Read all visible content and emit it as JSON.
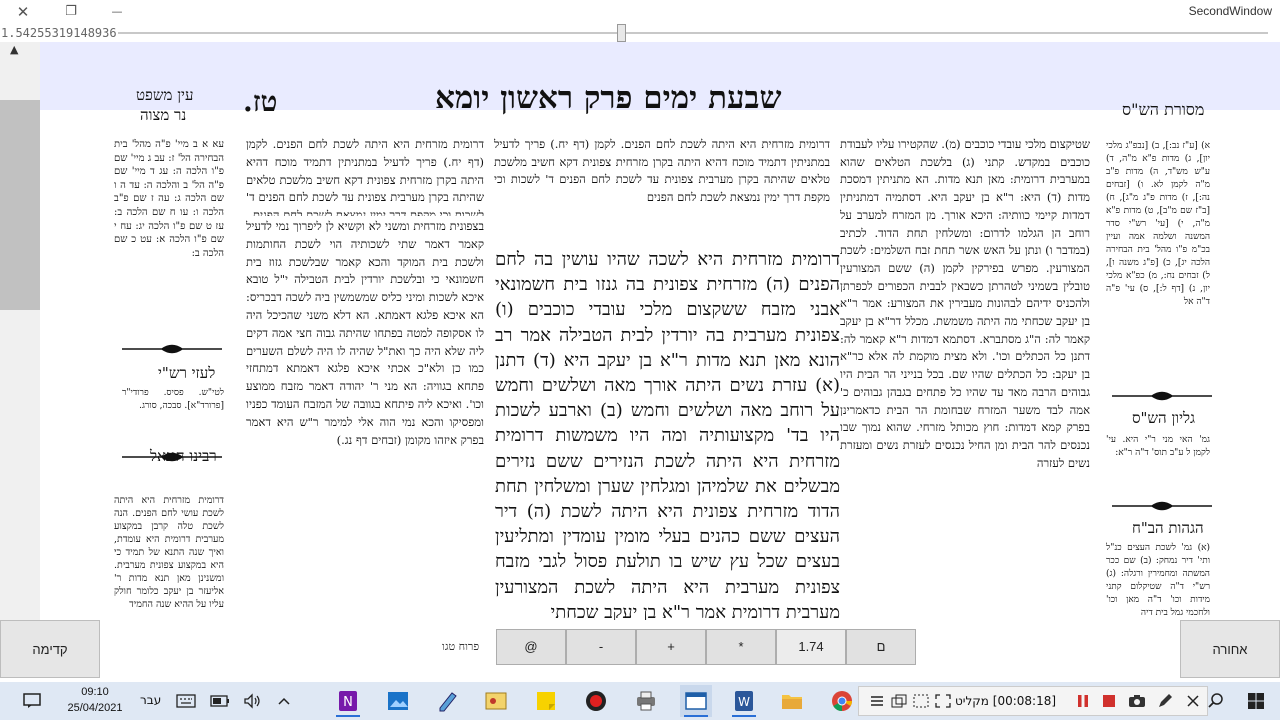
{
  "window": {
    "title": "SecondWindow",
    "close_glyph": "✕",
    "restore_glyph": "❐",
    "minimize_glyph": "—"
  },
  "coord_readout": "1.54255319148936",
  "scroll_up_glyph": "▲",
  "page": {
    "header_main": "שבעת ימים   פרק ראשון   יומא",
    "page_number": "טז.",
    "masoret_title": "מסורת הש\"ס",
    "ein_title": "עין משפט",
    "ner_title": "נר מצוה",
    "masoret_text": "א) [ע\"ז נב:], ב) [נבפ\"ג מלכי יון], ג) מדות פ\"א מ\"ה, ד) ע\"ש מש\"ד, ה) מדות פ\"ב מ\"ה לקמן לא. ו) [זבחים נה:], ז) מדות פ\"ג מ\"ג], ח) [ב\"ז שם מ\"ב], ט) מדות פ\"א מ\"ה, י) [עי' רש\"י סדר המשנה ושלמה אמה ועיין בכ\"מ פ\"ו מהל' בית הבחירה הלכה יג], כ) [פ\"ג משנה ו], ל) זבחים נח:, מ) כפ\"א מלכי יון, נ) [דף ל:], ס) עי' פ\"ה ד\"ה אל",
    "ein_text": "עא א ב מיי' פ\"ה מהל' בית הבחירה הל' ז: עב ג מיי' שם פ\"ו הלכה ה: עג ד מיי' שם פ\"ה הל' ב והלכה ה: עד ה ו שם הלכה ג: עה ז שם פ\"ב הלכה ו: עו ח שם הלכה ב: עז ט שם פ\"ו הלכה יג: עח י שם פ\"ו הלכה א: עט כ שם הלכה ב:",
    "laaz_title": "לעזי רש\"י",
    "laaz_text": "לטי\"ש. פסיס. פרודי\"ר [פרורד\"א]. סבכה, סורג.",
    "chananel_title": "רבינו חננאל",
    "chananel_text": "דרומית מזרחית היא היתה לשכת עושי לחם הפנים. הנה לשכת טלה קרבן במקצוע מערבית דרומית היא עומדת, ואיך שנה התנא של תמיד כי היא במקצוע צפונית מערבית. ומשנינן מאן תנא מדות ר' אליעזר בן יעקב כלומר חולק עליו על ההיא שנה החמיד",
    "gilyon_title": "גליון הש\"ס",
    "gilyon_text": "גמ' האי מני ר\"י היא. עי' לקמן ל ע\"ב תוס' ד\"ה ר\"א:",
    "hagahot_title": "הגהות הב\"ח",
    "hagahot_text": "(א) גמ' לשכת העצים כנ\"ל ותי' דיר נמחק: (ב) שם ככר המשתה ומחמירין ורגלה: (ג) רש\"י ד\"ה שטיקלום קתני מידות וכו' ד\"ה מאן וכו' ולחכמי גמל בית דיה",
    "rashi_right": "שטיקצום מלכי עובדי כוכבים (מ). שהקטירו עליו לעבודת כוכבים במקדש. קתני (ג) בלשכת הטלאים שהוא במערבית דרומית: מאן תנא מדות. הא מתניתין דמסכת מדות (ד) היא: ר\"א בן יעקב היא. דסתמיה דמתניתין דמדות קיימי כוותיה: היכא אורך. מן המזרח למערב על רוחב הן הגלמו לדרום: ומשלחין תחת הדוד. לכתיב (במדבר ו) ונתן על האש אשר תחת זבח השלמים: לשכת המצורעין. מפרש בפירקין לקמן (ה) ששם המצורעין טובלין בשמיני לטהרתן כשבאין לבבית הכפורים לכפרתן ולהכניס ידיהם לבהונות מעבירין את המצורע: אמר ר\"א בן יעקב שכחתי מה היתה משמשת. מכלל דר\"א בן יעקב קאמר לה: ה\"ג מסתברא. דסתמא דמדות ר\"א קאמר לה: דתנן כל הכתלים וכו'. ולא מצית מוקמת לה אלא כר\"א בן יעקב: כל הכתלים שהיו שם. בכל בנייני הר הבית היו גבוהים הרבה מאד עד שהיו כל פתחים בגבהן גבוהים כ' אמה לבד משער המזרח שבחומת הר הבית כדאמרינן בפרק קמא דמדות: חוץ מכותל מזרחי. שהוא נמוך שבו נכנסים להר הבית ומן החיל נכנסים לעזרת נשים ומעזרת נשים לעזרה",
    "rashi_mid": "דרומית מזרחית היא היתה לשכת לחם הפנים. לקמן (דף יח.) פריך לדעיל במתניתין דתמיד מוכח דהיא היתה בקרן מזרחית צפונית דקא חשיב מלשכת טלאים שהיתה בקרן מערבית צפונית עד לשכת לחם הפנים ד' לשכות וכי מקפת דרך ימין נמצאת לשכת לחם הפנים",
    "tosafot": "בצפונית מזרחית ומשני לא וקשיא לן ליפרוך נמי לדעיל קאמר דאמר שתי לשכותיה הוי לשכת החותמות ולשכת בית המוקד והכא קאמר שבלשכת גזוז בית חשמונאי כי ובלשכת יורדין לבית הטבילה י\"ל טובא איכא לשכות ומיני כליס שמשמשין ביה לשכה דבכריס: הא איכא פלגא דאמתא. הא דלא משני שהכיכל היה לו אסקופה למטה בפתחו שהיתה גבוה חצי אמה דקים ליה שלא היה כך ואת\"ל שהיה לו היה לשלם השערים כמו כן ולא\"כ אכתי איכא פלגא דאמתא דמתחזי פתחא בגוויה: הא מני ר' יהודה דאמר מזבח ממוצע וכו'. ואיכא ליה פיתחא בגוובה של המזבח העומד כפניו ומפסיקו והכא נמי הוה אלי למימר ר\"ש היא דאמר בפרק איזהו מקומן (זבחים דף נג.)",
    "gemara": "דרומית מזרחית היא לשכה שהיו עושין בה לחם הפנים (ה) מזרחית צפונית בה גנזו בית חשמונאי אבני מזבח ששקצום מלכי עובדי כוכבים (ו) צפונית מערבית בה יורדין לבית הטבילה אמר רב הונא מאן תנא מדות ר\"א בן יעקב היא (ד) דתנן (א) עזרת נשים היתה אורך מאה ושלשים וחמש על רוחב מאה ושלשים וחמש (ב) וארבע לשכות היו בד' מקצועותיה ומה היו משמשות דרומית מזרחית היא היתה לשכת הנזירים ששם נזירים מבשלים את שלמיהן ומגלחין שערן ומשלחין תחת הדוד מזרחית צפונית היא היתה לשכת (ה) דיר העצים ששם כהנים בעלי מומין עומדין ומתליעין בעצים שכל עץ שיש בו תולעת פסול לגבי מזבח צפונית מערבית היא היתה לשכת המצורעין מערבית דרומית אמר ר\"א בן יעקב שכחתי"
  },
  "toolbar": {
    "prev_label": "קדימה",
    "next_label": "אחורה",
    "at_label": "@",
    "minus_label": "-",
    "plus_label": "+",
    "star_label": "*",
    "zoom_value": "1.74",
    "d_label": "ם",
    "page_label": "פרוח טגו"
  },
  "taskbar": {
    "time": "09:10",
    "date": "25/04/2021",
    "lang": "עבר",
    "recorder_text": "[00:08:18] מקליט"
  }
}
